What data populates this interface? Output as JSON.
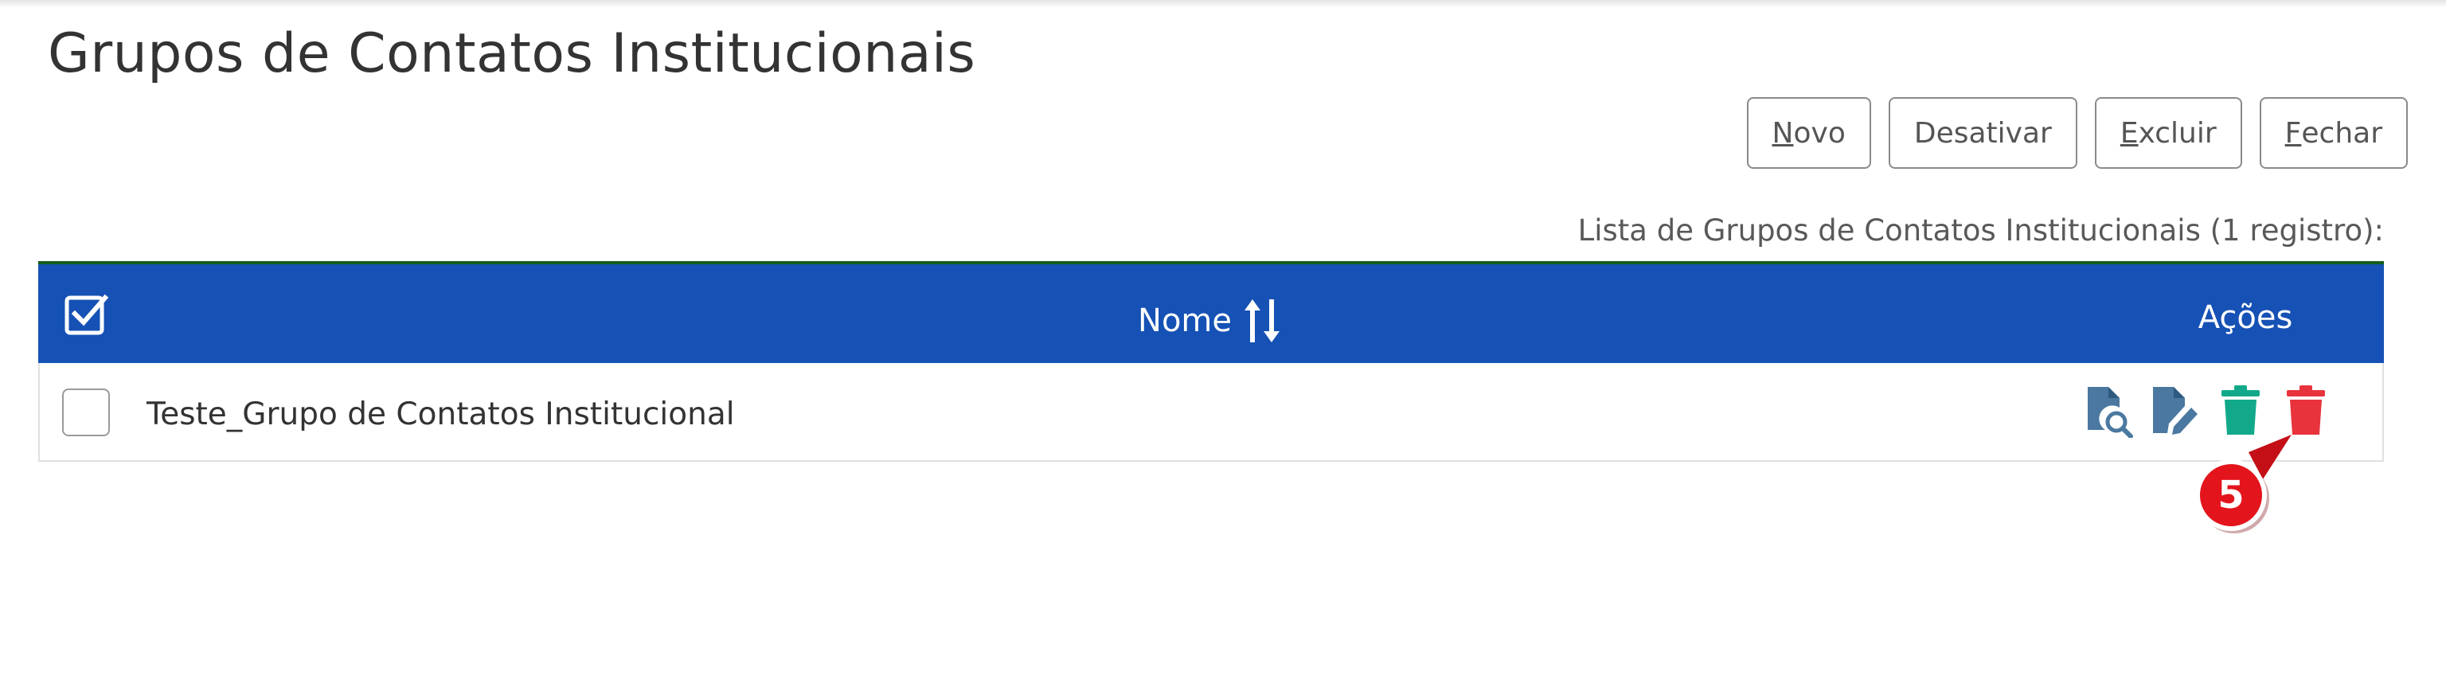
{
  "page": {
    "title": "Grupos de Contatos Institucionais"
  },
  "toolbar": {
    "buttons": [
      {
        "accel": "N",
        "rest": "ovo"
      },
      {
        "accel": "",
        "rest": "Desativar"
      },
      {
        "accel": "E",
        "rest": "xcluir"
      },
      {
        "accel": "F",
        "rest": "echar"
      }
    ]
  },
  "table": {
    "caption": "Lista de Grupos de Contatos Institucionais (1 registro):",
    "header": {
      "name": "Nome",
      "actions": "Ações"
    },
    "rows": [
      {
        "name": "Teste_Grupo de Contatos Institucional"
      }
    ],
    "row_action_icons": [
      "search-document-icon",
      "edit-document-icon",
      "trash-icon",
      "trash-icon"
    ]
  },
  "annotation": {
    "step": "5"
  },
  "colors": {
    "header_bg": "#1651b5",
    "table_topline": "#155c1a",
    "icon_blue": "#4a78a0",
    "icon_green": "#12a98a",
    "icon_red": "#e8333c",
    "badge_red": "#e3141c"
  }
}
